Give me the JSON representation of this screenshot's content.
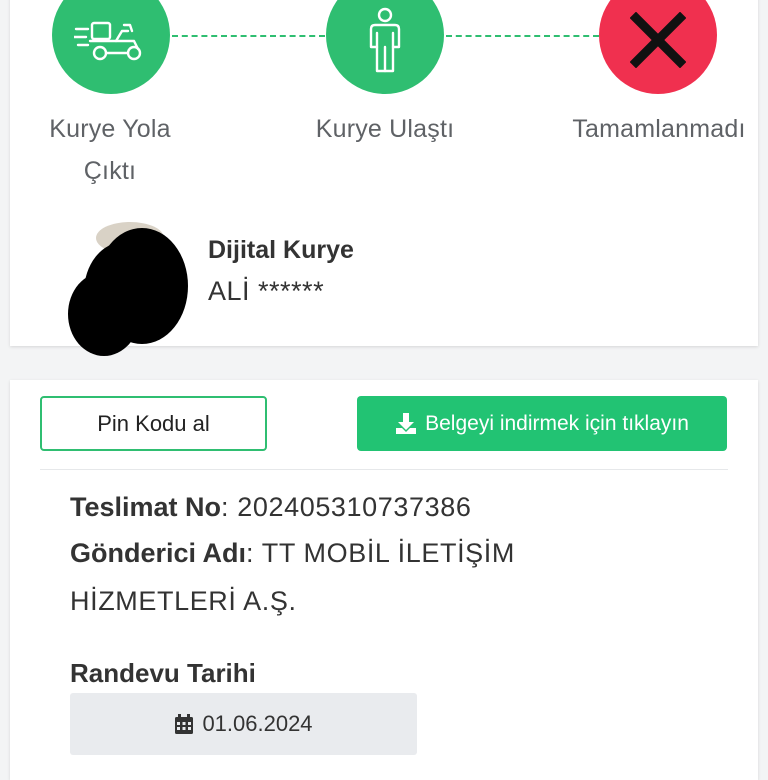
{
  "status_steps": [
    {
      "label_line1": "Kurye Yola",
      "label_line2": "Çıktı",
      "icon": "scooter-icon",
      "color": "#2fbe71"
    },
    {
      "label_line1": "Kurye Ulaştı",
      "icon": "person-icon",
      "color": "#2fbe71"
    },
    {
      "label_line1": "Tamamlanmadı",
      "icon": "x-icon",
      "color": "#f0304f"
    }
  ],
  "courier": {
    "title": "Dijital Kurye",
    "name": "ALİ ******"
  },
  "actions": {
    "pin_button": "Pin Kodu al",
    "download_button": "Belgeyi indirmek için tıklayın"
  },
  "details": {
    "delivery_no_label": "Teslimat No",
    "delivery_no_value": ": 202405310737386",
    "sender_label": "Gönderici Adı",
    "sender_value_line1": ": TT MOBİL İLETİŞİM",
    "sender_value_line2": "HİZMETLERİ A.Ş."
  },
  "appointment": {
    "label": "Randevu Tarihi",
    "date": "01.06.2024"
  },
  "colors": {
    "accent_green": "#2fbe71",
    "button_green": "#22c373",
    "error_red": "#f0304f"
  }
}
